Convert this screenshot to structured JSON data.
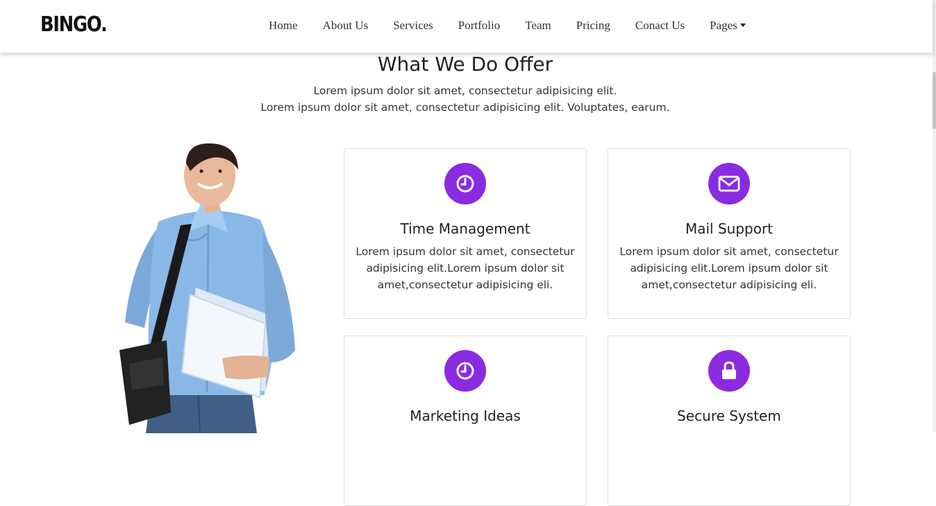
{
  "brand": "BINGO.",
  "nav": {
    "items": [
      "Home",
      "About Us",
      "Services",
      "Portfolio",
      "Team",
      "Pricing",
      "Conact Us",
      "Pages"
    ]
  },
  "section": {
    "title": "What We Do Offer",
    "subtitle_line1": "Lorem ipsum dolor sit amet, consectetur adipisicing elit.",
    "subtitle_line2": "Lorem ipsum dolor sit amet, consectetur adipisicing elit. Voluptates, earum."
  },
  "cards": [
    {
      "title": "Time Management",
      "text": "Lorem ipsum dolor sit amet, consectetur adipisicing elit.Lorem ipsum dolor sit amet,consectetur adipisicing eli.",
      "icon": "clock-icon"
    },
    {
      "title": "Mail Support",
      "text": "Lorem ipsum dolor sit amet, consectetur adipisicing elit.Lorem ipsum dolor sit amet,consectetur adipisicing eli.",
      "icon": "envelope-icon"
    },
    {
      "title": "Marketing Ideas",
      "text": "",
      "icon": "clock-icon"
    },
    {
      "title": "Secure System",
      "text": "",
      "icon": "lock-icon"
    }
  ],
  "colors": {
    "accent": "#8a2be2",
    "card_border": "#dedede",
    "text": "#222222"
  }
}
